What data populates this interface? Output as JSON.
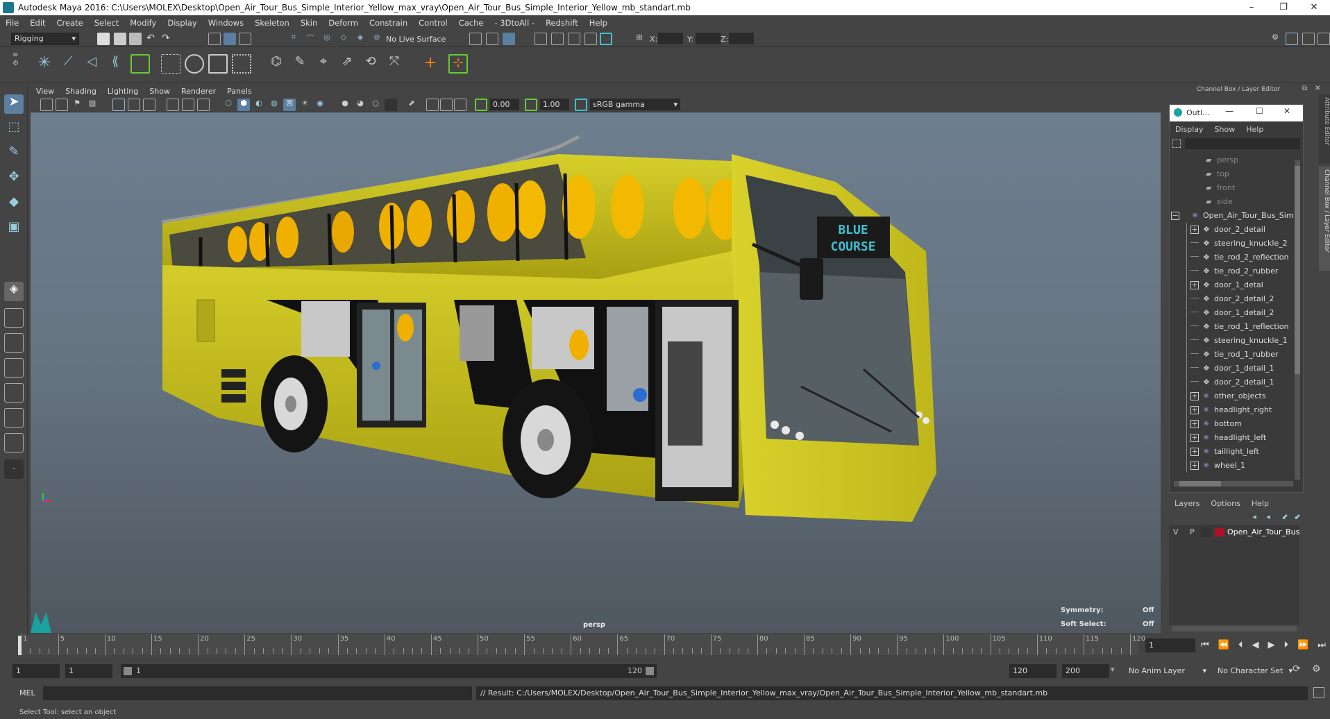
{
  "window": {
    "title": "Autodesk Maya 2016: C:\\Users\\MOLEX\\Desktop\\Open_Air_Tour_Bus_Simple_Interior_Yellow_max_vray\\Open_Air_Tour_Bus_Simple_Interior_Yellow_mb_standart.mb",
    "minimize": "–",
    "restore": "❐",
    "close": "✕"
  },
  "menubar": [
    "File",
    "Edit",
    "Create",
    "Select",
    "Modify",
    "Display",
    "Windows",
    "Skeleton",
    "Skin",
    "Deform",
    "Constrain",
    "Control",
    "Cache",
    "- 3DtoAll -",
    "Redshift",
    "Help"
  ],
  "statusline": {
    "mode": "Rigging",
    "live_surface": "No Live Surface",
    "x_label": "X:",
    "y_label": "Y:",
    "z_label": "Z:"
  },
  "viewport": {
    "menu": [
      "View",
      "Shading",
      "Lighting",
      "Show",
      "Renderer",
      "Panels"
    ],
    "near_value": "0.00",
    "far_value": "1.00",
    "color_space": "sRGB gamma",
    "camera_label": "persp",
    "hud": {
      "symmetry_label": "Symmetry:",
      "symmetry_value": "Off",
      "soft_select_label": "Soft Select:",
      "soft_select_value": "Off"
    }
  },
  "channel_box": {
    "title": "Channel Box / Layer Editor",
    "side_tab_1": "Attribute Editor",
    "side_tab_2": "Channel Box / Layer Editor"
  },
  "outliner": {
    "title": "Outl...",
    "menu": [
      "Display",
      "Show",
      "Help"
    ],
    "items": [
      {
        "label": "persp",
        "type": "camera",
        "level": 0,
        "expand": false,
        "dim": true
      },
      {
        "label": "top",
        "type": "camera",
        "level": 0,
        "expand": false,
        "dim": true
      },
      {
        "label": "front",
        "type": "camera",
        "level": 0,
        "expand": false,
        "dim": true
      },
      {
        "label": "side",
        "type": "camera",
        "level": 0,
        "expand": false,
        "dim": true
      },
      {
        "label": "Open_Air_Tour_Bus_Sim",
        "type": "group",
        "level": -1,
        "expand": true,
        "minus": true
      },
      {
        "label": "door_2_detail",
        "type": "mesh",
        "level": 1,
        "expand": true
      },
      {
        "label": "steering_knuckle_2",
        "type": "mesh",
        "level": 1,
        "expand": false
      },
      {
        "label": "tie_rod_2_reflection",
        "type": "mesh",
        "level": 1,
        "expand": false
      },
      {
        "label": "tie_rod_2_rubber",
        "type": "mesh",
        "level": 1,
        "expand": false
      },
      {
        "label": "door_1_detal",
        "type": "mesh",
        "level": 1,
        "expand": true
      },
      {
        "label": "door_2_detail_2",
        "type": "mesh",
        "level": 1,
        "expand": false
      },
      {
        "label": "door_1_detail_2",
        "type": "mesh",
        "level": 1,
        "expand": false
      },
      {
        "label": "tie_rod_1_reflection",
        "type": "mesh",
        "level": 1,
        "expand": false
      },
      {
        "label": "steering_knuckle_1",
        "type": "mesh",
        "level": 1,
        "expand": false
      },
      {
        "label": "tie_rod_1_rubber",
        "type": "mesh",
        "level": 1,
        "expand": false
      },
      {
        "label": "door_1_detail_1",
        "type": "mesh",
        "level": 1,
        "expand": false
      },
      {
        "label": "door_2_detail_1",
        "type": "mesh",
        "level": 1,
        "expand": false
      },
      {
        "label": "other_objects",
        "type": "group",
        "level": 1,
        "expand": true
      },
      {
        "label": "headlight_right",
        "type": "group",
        "level": 1,
        "expand": true
      },
      {
        "label": "bottom",
        "type": "group",
        "level": 1,
        "expand": true
      },
      {
        "label": "headlight_left",
        "type": "group",
        "level": 1,
        "expand": true
      },
      {
        "label": "taillight_left",
        "type": "group",
        "level": 1,
        "expand": true
      },
      {
        "label": "wheel_1",
        "type": "group",
        "level": 1,
        "expand": true
      }
    ]
  },
  "layers": {
    "menu": [
      "Layers",
      "Options",
      "Help"
    ],
    "row": {
      "v": "V",
      "p": "P",
      "name": "Open_Air_Tour_Bus_Si",
      "color": "#b0102a"
    }
  },
  "bus_sign": {
    "line1": "BLUE",
    "line2": "COURSE"
  },
  "timeline": {
    "ticks": [
      1,
      5,
      10,
      15,
      20,
      25,
      30,
      35,
      40,
      45,
      50,
      55,
      60,
      65,
      70,
      75,
      80,
      85,
      90,
      95,
      100,
      105,
      110,
      115,
      120
    ],
    "current_frame": "1",
    "start": "1",
    "end": 120
  },
  "range": {
    "start_field": "1",
    "start2_field": "1",
    "slider_start": "1",
    "slider_end": "120",
    "end_field": "120",
    "end2_field": "200",
    "anim_layer": "No Anim Layer",
    "char_set": "No Character Set"
  },
  "command": {
    "lang": "MEL",
    "result": "// Result: C:/Users/MOLEX/Desktop/Open_Air_Tour_Bus_Simple_Interior_Yellow_max_vray/Open_Air_Tour_Bus_Simple_Interior_Yellow_mb_standart.mb"
  },
  "helpline": "Select Tool: select an object",
  "colors": {
    "bus_yellow": "#c9c21c",
    "seat_yellow": "#f0b000",
    "accent_cyan": "#3fc0d0",
    "ui_dark": "#444444"
  }
}
